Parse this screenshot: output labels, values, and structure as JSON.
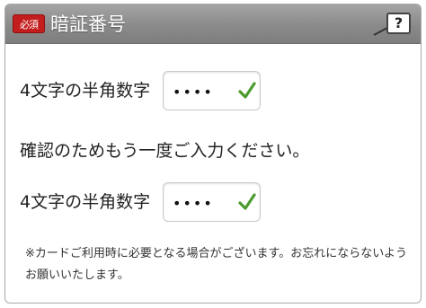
{
  "header": {
    "required_badge": "必須",
    "title": "暗証番号",
    "help_label": "?"
  },
  "pin": {
    "label": "4文字の半角数字",
    "value": "••••"
  },
  "confirm": {
    "instruction": "確認のためもう一度ご入力ください。",
    "label": "4文字の半角数字",
    "value": "••••"
  },
  "note": "※カードご利用時に必要となる場合がございます。お忘れにならないようお願いいたします。",
  "colors": {
    "required_badge": "#c31d1d",
    "valid_check": "#4a9a2e"
  }
}
